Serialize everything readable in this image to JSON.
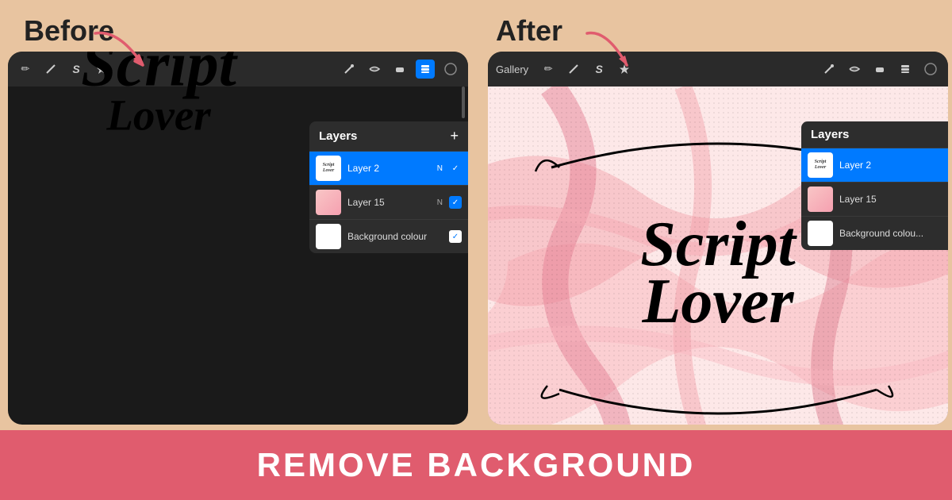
{
  "labels": {
    "before": "Before",
    "after": "After"
  },
  "banner": {
    "text": "REMOVE BACKGROUND"
  },
  "layers_panel": {
    "title": "Layers",
    "add_icon": "+",
    "layers": [
      {
        "name": "Layer 2",
        "mode": "N",
        "selected": true
      },
      {
        "name": "Layer 15",
        "mode": "N",
        "selected": false
      },
      {
        "name": "Background colour",
        "mode": "",
        "selected": false
      }
    ]
  },
  "toolbar": {
    "gallery_label": "Gallery",
    "icons": [
      "✏️",
      "⚡",
      "S",
      "✦",
      "⬛",
      "●"
    ]
  },
  "colors": {
    "background": "#e8c4a0",
    "banner_bg": "#e05c6e",
    "banner_text": "#ffffff",
    "selected_layer": "#007AFF",
    "arrow": "#e05c6e"
  }
}
